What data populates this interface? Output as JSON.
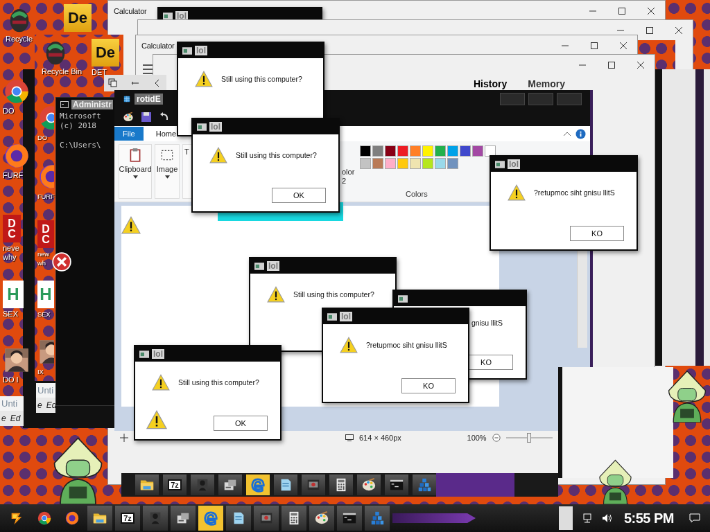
{
  "desktop_icons": [
    {
      "kind": "bin",
      "label": "Recycle"
    },
    {
      "kind": "de",
      "mark": "De"
    },
    {
      "kind": "chrome",
      "label": "DO"
    },
    {
      "kind": "firefox",
      "label": "FURF"
    },
    {
      "kind": "dc",
      "mark": "D C",
      "label": "neve why"
    },
    {
      "kind": "hx",
      "mark": "H",
      "label": "SEX"
    },
    {
      "kind": "portrait",
      "label": "DO I"
    },
    {
      "kind": "bin",
      "label": "Recycle Bin"
    },
    {
      "kind": "de",
      "mark": "De",
      "label": "DET"
    },
    {
      "kind": "chrome",
      "label": "DO"
    },
    {
      "kind": "firefox",
      "label": "FURF"
    },
    {
      "kind": "dc",
      "mark": "D C",
      "label": "new wh"
    },
    {
      "kind": "hx",
      "mark": "H",
      "label": "SEX"
    },
    {
      "kind": "portrait",
      "label": "IX"
    }
  ],
  "notepads": [
    {
      "title": "Unti",
      "menu": [
        "e",
        "Ed"
      ]
    },
    {
      "title": "Unti",
      "menu": [
        "e",
        "Ed"
      ]
    }
  ],
  "calculators": [
    {
      "kind": "calculator",
      "title": "Calculator"
    },
    {
      "kind": "calculator"
    },
    {
      "kind": "calculator",
      "title": "Calculator"
    },
    {
      "kind": "calculator",
      "tabs": [
        {
          "label": "History",
          "selected": true
        },
        {
          "label": "Memory",
          "selected": false
        }
      ]
    }
  ],
  "console": {
    "title": "Administr",
    "lines": [
      "Microsoft",
      "(c) 2018",
      "C:\\Users\\"
    ]
  },
  "paint": {
    "title": "rotidE",
    "tabs": [
      {
        "label": "File",
        "selected": true
      },
      {
        "label": "Home",
        "selected": false
      }
    ],
    "groups": [
      "Clipboard",
      "Image",
      "T"
    ],
    "color2": "olor 2",
    "colors_label": "Colors",
    "palette": [
      {
        "color": "#000000"
      },
      {
        "color": "#7f7f7f"
      },
      {
        "color": "#880015"
      },
      {
        "color": "#ed1c24"
      },
      {
        "color": "#ff7f27"
      },
      {
        "color": "#fff200"
      },
      {
        "color": "#22b14c"
      },
      {
        "color": "#00a2e8"
      },
      {
        "color": "#3f48cc"
      },
      {
        "color": "#a349a4"
      },
      {
        "color": "#ffffff"
      },
      {
        "color": "#c3c3c3"
      },
      {
        "color": "#b97a57"
      },
      {
        "color": "#ffaec9"
      },
      {
        "color": "#ffc90e"
      },
      {
        "color": "#efe4b0"
      },
      {
        "color": "#b5e61d"
      },
      {
        "color": "#99d9ea"
      },
      {
        "color": "#7092be"
      }
    ],
    "size": "614 × 460px",
    "zoom": "100%",
    "zoom_slider": {
      "level": 0.5
    }
  },
  "dialogs": [
    {
      "title": "lol"
    },
    {
      "title": "lol",
      "message": "Still using this computer?",
      "warning": true
    },
    {
      "title": "lol",
      "message": "Still using this computer?",
      "warning": true,
      "button": "OK"
    },
    {
      "title": "lol",
      "message": "?retupmoc siht gnisu llitS",
      "warning": true,
      "button": "KO"
    },
    {
      "title": "lol",
      "message": "Still using this computer?",
      "warning": true
    },
    {
      "message": "gnisu llitS",
      "warning": false,
      "button": "KO"
    },
    {
      "title": "lol",
      "message": "?retupmoc siht gnisu llitS",
      "warning": true,
      "button": "KO"
    },
    {
      "title": "lol",
      "message": "Still using this computer?",
      "warning": true,
      "button": "OK"
    }
  ],
  "fake_taskbar": {
    "items": [
      {
        "kind": "folder",
        "selected": false
      },
      {
        "kind": "archive",
        "label": "7z",
        "selected": false
      },
      {
        "kind": "user",
        "selected": false
      },
      {
        "kind": "drive",
        "selected": false
      },
      {
        "kind": "edge",
        "selected": true
      },
      {
        "kind": "notepad",
        "selected": false
      },
      {
        "kind": "media",
        "selected": false
      },
      {
        "kind": "calc",
        "selected": false
      },
      {
        "kind": "paint",
        "selected": false
      },
      {
        "kind": "cmd",
        "selected": false
      },
      {
        "kind": "network",
        "selected": false
      }
    ]
  },
  "taskbar": {
    "items": [
      {
        "kind": "start",
        "selected": false
      },
      {
        "kind": "chrome",
        "selected": false
      },
      {
        "kind": "firefox",
        "selected": false
      },
      {
        "kind": "folder",
        "selected": false
      },
      {
        "kind": "archive",
        "label": "7z",
        "selected": false
      },
      {
        "kind": "user",
        "selected": false
      },
      {
        "kind": "drive",
        "selected": false
      },
      {
        "kind": "edge",
        "selected": true
      },
      {
        "kind": "notepad",
        "selected": false
      },
      {
        "kind": "media",
        "selected": false
      },
      {
        "kind": "calc",
        "selected": false
      },
      {
        "kind": "paint",
        "selected": false
      },
      {
        "kind": "cmd",
        "selected": false
      },
      {
        "kind": "network",
        "selected": false
      }
    ],
    "clock": "5:55 PM"
  }
}
